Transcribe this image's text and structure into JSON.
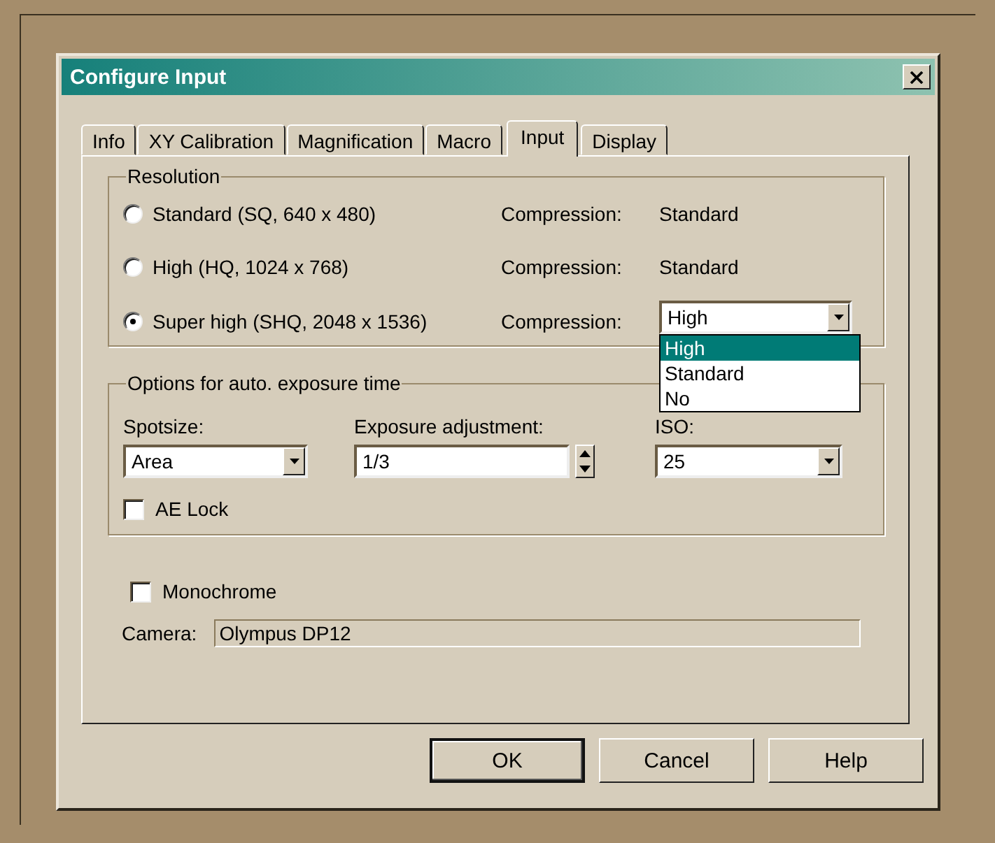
{
  "window": {
    "title": "Configure Input"
  },
  "tabs": [
    {
      "label": "Info",
      "selected": false
    },
    {
      "label": "XY Calibration",
      "selected": false
    },
    {
      "label": "Magnification",
      "selected": false
    },
    {
      "label": "Macro",
      "selected": false
    },
    {
      "label": "Input",
      "selected": true
    },
    {
      "label": "Display",
      "selected": false
    }
  ],
  "resolution": {
    "title": "Resolution",
    "options": [
      {
        "label": "Standard (SQ, 640 x 480)",
        "selected": false,
        "compression_label": "Compression:",
        "compression": {
          "kind": "text",
          "value": "Standard"
        }
      },
      {
        "label": "High (HQ, 1024 x 768)",
        "selected": false,
        "compression_label": "Compression:",
        "compression": {
          "kind": "text",
          "value": "Standard"
        }
      },
      {
        "label": "Super high (SHQ, 2048 x 1536)",
        "selected": true,
        "compression_label": "Compression:",
        "compression": {
          "kind": "dropdown",
          "value": "High",
          "expanded": true,
          "items": [
            {
              "label": "High",
              "selected": true
            },
            {
              "label": "Standard",
              "selected": false
            },
            {
              "label": "No",
              "selected": false
            }
          ]
        }
      }
    ]
  },
  "exposure": {
    "title": "Options for auto. exposure time",
    "spotsize": {
      "label": "Spotsize:",
      "value": "Area"
    },
    "adjustment": {
      "label": "Exposure adjustment:",
      "value": "1/3"
    },
    "iso": {
      "label": "ISO:",
      "value": "25"
    },
    "ae_lock": {
      "label": "AE Lock",
      "checked": false
    }
  },
  "monochrome": {
    "label": "Monochrome",
    "checked": false
  },
  "camera": {
    "label": "Camera:",
    "value": "Olympus DP12"
  },
  "buttons": [
    {
      "label": "OK",
      "default": true
    },
    {
      "label": "Cancel",
      "default": false
    },
    {
      "label": "Help",
      "default": false
    }
  ]
}
